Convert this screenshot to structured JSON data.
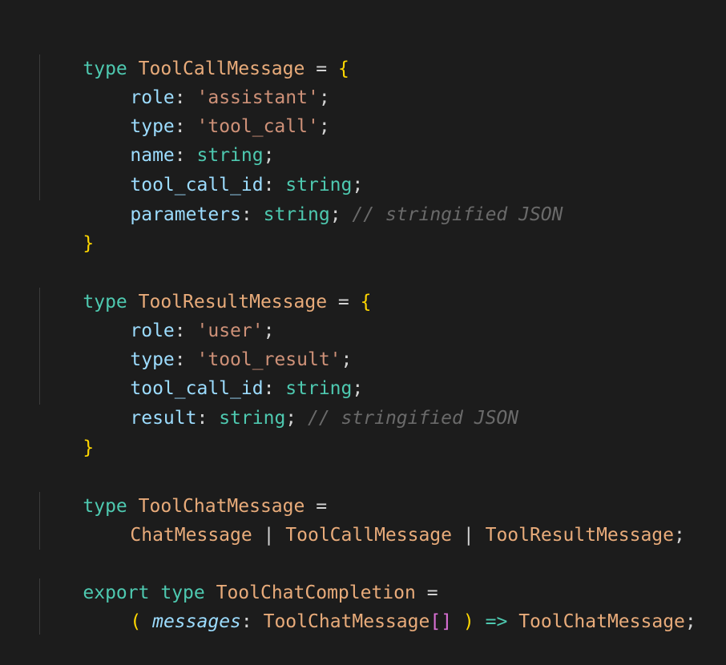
{
  "code": {
    "block1": {
      "kw": "type",
      "name": "ToolCallMessage",
      "eq": "=",
      "open": "{",
      "close": "}",
      "fields": [
        {
          "key": "role",
          "colon": ":",
          "val": "'assistant'",
          "semi": ";"
        },
        {
          "key": "type",
          "colon": ":",
          "val": "'tool_call'",
          "semi": ";"
        },
        {
          "key": "name",
          "colon": ":",
          "val": "string",
          "semi": ";"
        },
        {
          "key": "tool_call_id",
          "colon": ":",
          "val": "string",
          "semi": ";"
        },
        {
          "key": "parameters",
          "colon": ":",
          "val": "string",
          "semi": ";",
          "comment": "// stringified JSON"
        }
      ]
    },
    "block2": {
      "kw": "type",
      "name": "ToolResultMessage",
      "eq": "=",
      "open": "{",
      "close": "}",
      "fields": [
        {
          "key": "role",
          "colon": ":",
          "val": "'user'",
          "semi": ";"
        },
        {
          "key": "type",
          "colon": ":",
          "val": "'tool_result'",
          "semi": ";"
        },
        {
          "key": "tool_call_id",
          "colon": ":",
          "val": "string",
          "semi": ";"
        },
        {
          "key": "result",
          "colon": ":",
          "val": "string",
          "semi": ";",
          "comment": "// stringified JSON"
        }
      ]
    },
    "block3": {
      "kw": "type",
      "name": "ToolChatMessage",
      "eq": "=",
      "union": [
        "ChatMessage",
        "ToolCallMessage",
        "ToolResultMessage"
      ],
      "pipe": "|",
      "semi": ";"
    },
    "block4": {
      "kw_export": "export",
      "kw": "type",
      "name": "ToolChatCompletion",
      "eq": "=",
      "paren_open": "(",
      "param": "messages",
      "colon": ":",
      "param_type": "ToolChatMessage",
      "array_open": "[",
      "array_close": "]",
      "paren_close": ")",
      "arrow": "=>",
      "return_type": "ToolChatMessage",
      "semi": ";"
    }
  },
  "colors": {
    "background": "#1c1c1c",
    "keyword": "#4ec9b0",
    "type_name": "#e8ab7a",
    "property": "#9cdcfe",
    "string": "#ce9178",
    "bracket": "#ffd700",
    "bracket_magenta": "#da70d6",
    "comment": "#6a6a6a"
  }
}
